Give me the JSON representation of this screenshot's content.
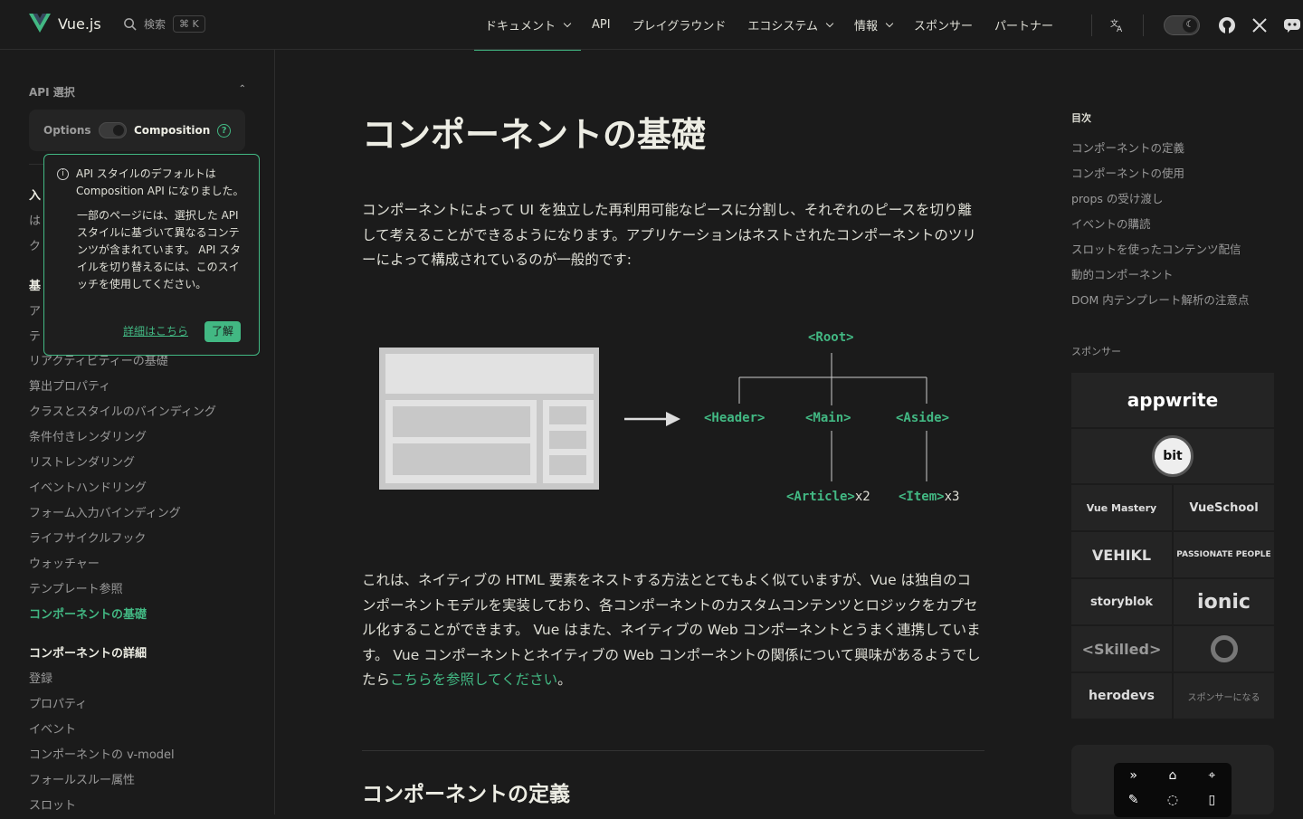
{
  "header": {
    "site_name": "Vue.js",
    "search_label": "検索",
    "search_kbd": "⌘ K",
    "nav": [
      {
        "label": "ドキュメント",
        "dropdown": true
      },
      {
        "label": "API",
        "dropdown": false
      },
      {
        "label": "プレイグラウンド",
        "dropdown": false
      },
      {
        "label": "エコシステム",
        "dropdown": true
      },
      {
        "label": "情報",
        "dropdown": true
      },
      {
        "label": "スポンサー",
        "dropdown": false
      },
      {
        "label": "パートナー",
        "dropdown": false
      }
    ],
    "icons": [
      "translate-icon",
      "dark-mode-toggle",
      "github-icon",
      "x-icon",
      "discord-icon"
    ],
    "accent_color": "#42b883"
  },
  "sidebar": {
    "api_heading": "API 選択",
    "api_options": "Options",
    "api_composition": "Composition",
    "help_glyph": "?",
    "partial_items": [
      "入",
      "は",
      "ク",
      "基",
      "ア",
      "テ"
    ],
    "items": [
      "リアクティビティーの基礎",
      "算出プロパティ",
      "クラスとスタイルのバインディング",
      "条件付きレンダリング",
      "リストレンダリング",
      "イベントハンドリング",
      "フォーム入力バインディング",
      "ライフサイクルフック",
      "ウォッチャー",
      "テンプレート参照",
      "コンポーネントの基礎"
    ],
    "active_item": "コンポーネントの基礎",
    "section2_heading": "コンポーネントの詳細",
    "section2_items": [
      "登録",
      "プロパティ",
      "イベント",
      "コンポーネントの v-model",
      "フォールスルー属性",
      "スロット"
    ]
  },
  "popup": {
    "line1": "API スタイルのデフォルトは Composition API になりました。",
    "line2": "一部のページには、選択した API スタイルに基づいて異なるコンテンツが含まれています。 API スタイルを切り替えるには、このスイッチを使用してください。",
    "learn_more": "詳細はこちら",
    "ok": "了解"
  },
  "main": {
    "title": "コンポーネントの基礎",
    "intro": "コンポーネントによって UI を独立した再利用可能なピースに分割し、それぞれのピースを切り離して考えることができるようになります。アプリケーションはネストされたコンポーネントのツリーによって構成されているのが一般的です:",
    "para2_text": "これは、ネイティブの HTML 要素をネストする方法ととてもよく似ていますが、Vue は独自のコンポーネントモデルを実装しており、各コンポーネントのカスタムコンテンツとロジックをカプセル化することができます。 Vue はまた、ネイティブの Web コンポーネントとうまく連携しています。 Vue コンポーネントとネイティブの Web コンポーネントの関係について興味があるようでしたら",
    "para2_link": "こちらを参照してください",
    "para2_end": "。",
    "section_title": "コンポーネントの定義",
    "diagram": {
      "root": "<Root>",
      "header": "<Header>",
      "main": "<Main>",
      "aside": "<Aside>",
      "article": "<Article>",
      "article_count": "x2",
      "item": "<Item>",
      "item_count": "x3"
    }
  },
  "toc": {
    "heading": "目次",
    "items": [
      "コンポーネントの定義",
      "コンポーネントの使用",
      "props の受け渡し",
      "イベントの購読",
      "スロットを使ったコンテンツ配信",
      "動的コンポーネント",
      "DOM 内テンプレート解析の注意点"
    ]
  },
  "sponsors": {
    "heading": "スポンサー",
    "big1": "appwrite",
    "big2": "bit",
    "grid": [
      "Vue Mastery",
      "VueSchool",
      "VEHIKL",
      "PASSIONATE PEOPLE",
      "storyblok",
      "ionic",
      "<Skilled>",
      "",
      "herodevs",
      "スポンサーになる"
    ]
  }
}
